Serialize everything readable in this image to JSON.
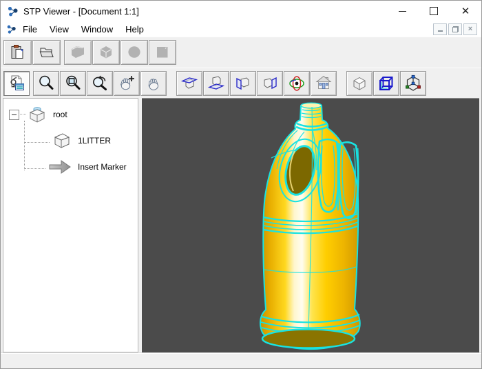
{
  "window": {
    "title": "STP Viewer - [Document 1:1]",
    "controls": {
      "minimize": "minimize-icon",
      "maximize": "maximize-icon",
      "close": "close-icon"
    },
    "mdi_controls": {
      "minimize": "mdi-minimize-icon",
      "restore": "mdi-restore-icon",
      "close": "mdi-close-icon"
    }
  },
  "menubar": {
    "items": [
      "File",
      "View",
      "Window",
      "Help"
    ]
  },
  "toolbar_standard": {
    "icons": [
      "paste-icon",
      "open-file-icon",
      "box-primitive-icon",
      "cube-primitive-icon",
      "sphere-primitive-icon",
      "plane-primitive-icon"
    ],
    "disabled": [
      "box-primitive-icon",
      "cube-primitive-icon",
      "sphere-primitive-icon",
      "plane-primitive-icon"
    ]
  },
  "toolbar_view": {
    "icons": [
      "zoom-fit-icon",
      "zoom-icon",
      "zoom-window-icon",
      "zoom-rotate-icon",
      "pan-hand-icon",
      "rotate-hand-icon",
      "view-top-icon",
      "view-bottom-icon",
      "view-left-icon",
      "view-right-icon",
      "perspective-eye-icon",
      "home-view-icon",
      "shaded-mode-icon",
      "wireframe-mode-icon",
      "axes-mode-icon"
    ],
    "active": "zoom-fit-icon"
  },
  "tree": {
    "items": [
      {
        "label": "root",
        "icon": "assembly-icon",
        "expanded": true
      },
      {
        "label": "1LITTER",
        "icon": "part-cube-icon"
      },
      {
        "label": "Insert Marker",
        "icon": "insert-marker-arrow-icon"
      }
    ]
  },
  "viewport": {
    "background": "#4B4B4B",
    "model": {
      "name": "1-litre plastic bottle",
      "body_color": "#FFD400",
      "edge_color": "#19E2E2",
      "bottom_color": "#8A7400"
    }
  },
  "statusbar": {
    "text": ""
  }
}
